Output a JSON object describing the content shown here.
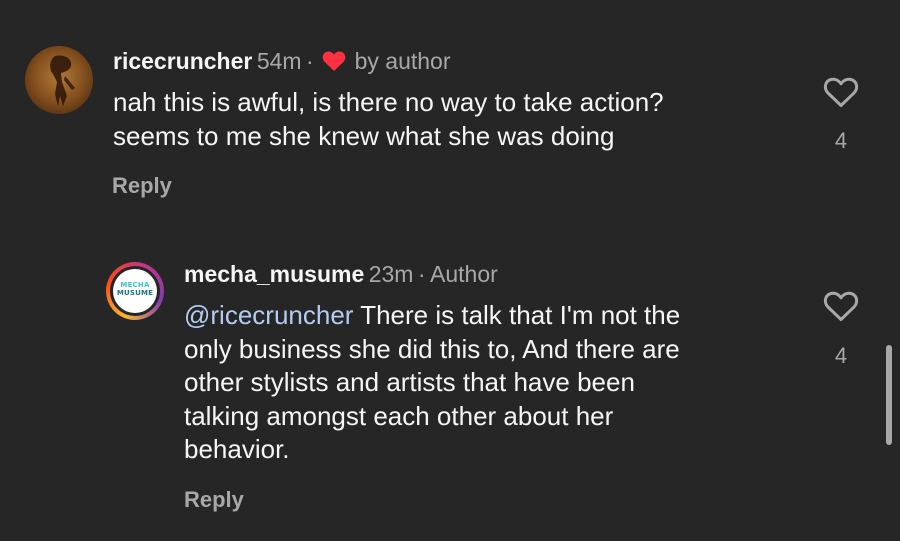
{
  "comments": [
    {
      "username": "ricecruncher",
      "time": "54m",
      "separator": "·",
      "badge": "by author",
      "badge_icon": "heart-filled-icon",
      "text_lines": [
        "nah this is awful, is there no way to take action?",
        "seems to me she knew what she was doing"
      ],
      "reply_label": "Reply",
      "like_count": "4"
    },
    {
      "username": "mecha_musume",
      "time": "23m",
      "separator": "·",
      "badge": "Author",
      "mention": "@ricecruncher",
      "text_lines": [
        " There is talk that I'm not the",
        "only business she did this to, And there are",
        "other stylists and artists that have been",
        "talking amongst each other about her",
        "behavior."
      ],
      "reply_label": "Reply",
      "like_count": "4",
      "avatar_logo": [
        "MECHA",
        "MUSUME"
      ]
    }
  ],
  "colors": {
    "background": "#262626",
    "primary_text": "#f5f5f5",
    "secondary_text": "#a8a8a8",
    "mention": "#b4ccf2",
    "heart_red": "#ff3040"
  }
}
